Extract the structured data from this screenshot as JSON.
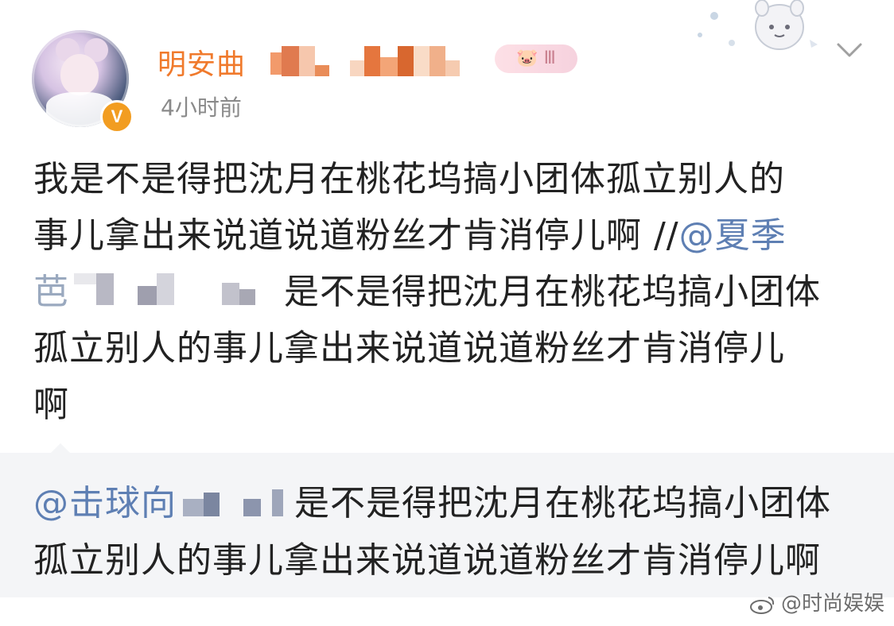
{
  "post": {
    "username": "明安曲",
    "level_badge": "Ⅲ",
    "time": "4小时前",
    "line1": "我是不是得把沈月在桃花坞搞小团体孤立别人的",
    "line2_text": "事儿拿出来说道说道粉丝才肯消停儿啊 //",
    "line2_mention": "@夏季",
    "line3_prefix": "芭",
    "line3_text": "是不是得把沈月在桃花坞搞小团体",
    "line4": "孤立别人的事儿拿出来说道说道粉丝才肯消停儿",
    "line5": "啊"
  },
  "quote": {
    "mention": "@击球向",
    "line1_text": "是不是得把沈月在桃花坞搞小团体",
    "line2": "孤立别人的事儿拿出来说道说道粉丝才肯消停儿啊"
  },
  "watermark": {
    "text": "@时尚娱娱"
  },
  "colors": {
    "username": "#f07a2c",
    "mention": "#5e7fb3",
    "quote_bg": "#f4f5f7",
    "verified_badge": "#f29d21"
  },
  "icons": {
    "verified": "verified-v-icon",
    "chevron": "chevron-down-icon",
    "weibo": "weibo-logo-icon"
  }
}
